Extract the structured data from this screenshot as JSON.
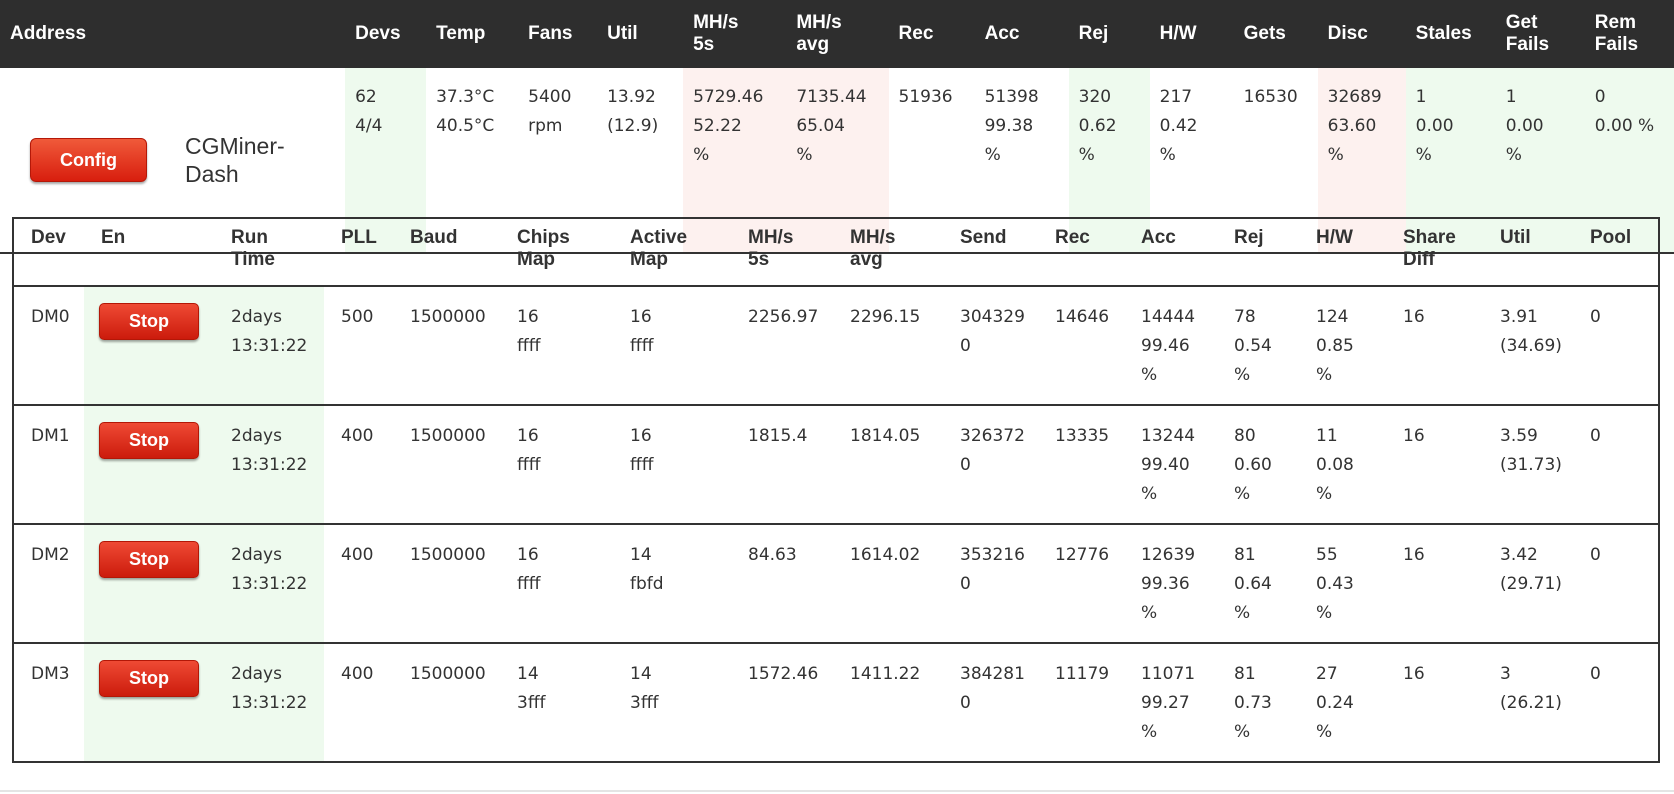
{
  "summary": {
    "headers": {
      "address": "Address",
      "devs": "Devs",
      "temp": "Temp",
      "fans": "Fans",
      "util": "Util",
      "mhs5s_a": "MH/s",
      "mhs5s_b": "5s",
      "mhsavg_a": "MH/s",
      "mhsavg_b": "avg",
      "rec": "Rec",
      "acc": "Acc",
      "rej": "Rej",
      "hw": "H/W",
      "gets": "Gets",
      "disc": "Disc",
      "stales": "Stales",
      "getfails_a": "Get",
      "getfails_b": "Fails",
      "remfails_a": "Rem",
      "remfails_b": "Fails"
    },
    "row": {
      "config_label": "Config",
      "host_name": "CGMiner-Dash",
      "devs": [
        "62",
        "4/4"
      ],
      "temp": [
        "37.3°C",
        "40.5°C"
      ],
      "fans": [
        "5400",
        "rpm"
      ],
      "util": [
        "13.92",
        "(12.9)"
      ],
      "mhs5s": [
        "5729.46",
        "52.22",
        "%"
      ],
      "mhsavg": [
        "7135.44",
        "65.04",
        "%"
      ],
      "rec": [
        "51936"
      ],
      "acc": [
        "51398",
        "99.38",
        "%"
      ],
      "rej": [
        "320",
        "0.62",
        "%"
      ],
      "hw": [
        "217",
        "0.42",
        "%"
      ],
      "gets": [
        "16530"
      ],
      "disc": [
        "32689",
        "63.60",
        "%"
      ],
      "stales": [
        "1",
        "0.00",
        "%"
      ],
      "getfails": [
        "1",
        "0.00",
        "%"
      ],
      "remfails": [
        "0",
        "0.00 %"
      ]
    }
  },
  "devices": {
    "headers": {
      "dev": "Dev",
      "en": "En",
      "runtime_a": "Run",
      "runtime_b": "Time",
      "pll": "PLL",
      "baud": "Baud",
      "chips_a": "Chips",
      "chips_b": "Map",
      "active_a": "Active",
      "active_b": "Map",
      "mhs5s_a": "MH/s",
      "mhs5s_b": "5s",
      "mhsavg_a": "MH/s",
      "mhsavg_b": "avg",
      "send": "Send",
      "rec": "Rec",
      "acc": "Acc",
      "rej": "Rej",
      "hw": "H/W",
      "sharediff_a": "Share",
      "sharediff_b": "Diff",
      "util": "Util",
      "pool": "Pool"
    },
    "stop_label": "Stop",
    "rows": [
      {
        "dev": "DM0",
        "runtime": [
          "2days",
          "13:31:22"
        ],
        "pll": "500",
        "baud": "1500000",
        "chips": [
          "16",
          "ffff"
        ],
        "active": [
          "16",
          "ffff"
        ],
        "mhs5s": "2256.97",
        "mhsavg": "2296.15",
        "send": [
          "304329",
          "0"
        ],
        "rec": "14646",
        "acc": [
          "14444",
          "99.46",
          "%"
        ],
        "rej": [
          "78",
          "0.54",
          "%"
        ],
        "hw": [
          "124",
          "0.85",
          "%"
        ],
        "sharediff": "16",
        "util": [
          "3.91",
          "(34.69)"
        ],
        "pool": "0"
      },
      {
        "dev": "DM1",
        "runtime": [
          "2days",
          "13:31:22"
        ],
        "pll": "400",
        "baud": "1500000",
        "chips": [
          "16",
          "ffff"
        ],
        "active": [
          "16",
          "ffff"
        ],
        "mhs5s": "1815.4",
        "mhsavg": "1814.05",
        "send": [
          "326372",
          "0"
        ],
        "rec": "13335",
        "acc": [
          "13244",
          "99.40",
          "%"
        ],
        "rej": [
          "80",
          "0.60",
          "%"
        ],
        "hw": [
          "11",
          "0.08",
          "%"
        ],
        "sharediff": "16",
        "util": [
          "3.59",
          "(31.73)"
        ],
        "pool": "0"
      },
      {
        "dev": "DM2",
        "runtime": [
          "2days",
          "13:31:22"
        ],
        "pll": "400",
        "baud": "1500000",
        "chips": [
          "16",
          "ffff"
        ],
        "active": [
          "14",
          "fbfd"
        ],
        "mhs5s": "84.63",
        "mhsavg": "1614.02",
        "send": [
          "353216",
          "0"
        ],
        "rec": "12776",
        "acc": [
          "12639",
          "99.36",
          "%"
        ],
        "rej": [
          "81",
          "0.64",
          "%"
        ],
        "hw": [
          "55",
          "0.43",
          "%"
        ],
        "sharediff": "16",
        "util": [
          "3.42",
          "(29.71)"
        ],
        "pool": "0"
      },
      {
        "dev": "DM3",
        "runtime": [
          "2days",
          "13:31:22"
        ],
        "pll": "400",
        "baud": "1500000",
        "chips": [
          "14",
          "3fff"
        ],
        "active": [
          "14",
          "3fff"
        ],
        "mhs5s": "1572.46",
        "mhsavg": "1411.22",
        "send": [
          "384281",
          "0"
        ],
        "rec": "11179",
        "acc": [
          "11071",
          "99.27",
          "%"
        ],
        "rej": [
          "81",
          "0.73",
          "%"
        ],
        "hw": [
          "27",
          "0.24",
          "%"
        ],
        "sharediff": "16",
        "util": [
          "3",
          "(26.21)"
        ],
        "pool": "0"
      }
    ]
  }
}
